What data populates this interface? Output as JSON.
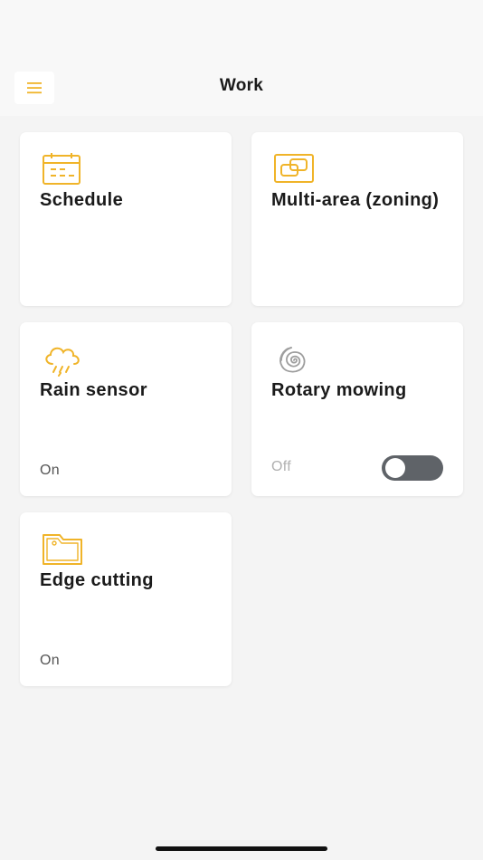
{
  "header": {
    "title": "Work",
    "menu_icon": "hamburger-menu-icon"
  },
  "colors": {
    "accent": "#f0b429",
    "toggle_off": "#5f6368",
    "spiral_icon": "#9e9e9e"
  },
  "cards": [
    {
      "title": "Schedule",
      "icon": "calendar-icon"
    },
    {
      "title": "Multi-area (zoning)",
      "icon": "zoning-icon"
    },
    {
      "title": "Rain sensor",
      "icon": "rain-cloud-icon",
      "status": "On"
    },
    {
      "title": "Rotary mowing",
      "icon": "spiral-icon",
      "status": "Off",
      "toggle_on": false
    },
    {
      "title": "Edge cutting",
      "icon": "edge-boundary-icon",
      "status": "On"
    }
  ]
}
